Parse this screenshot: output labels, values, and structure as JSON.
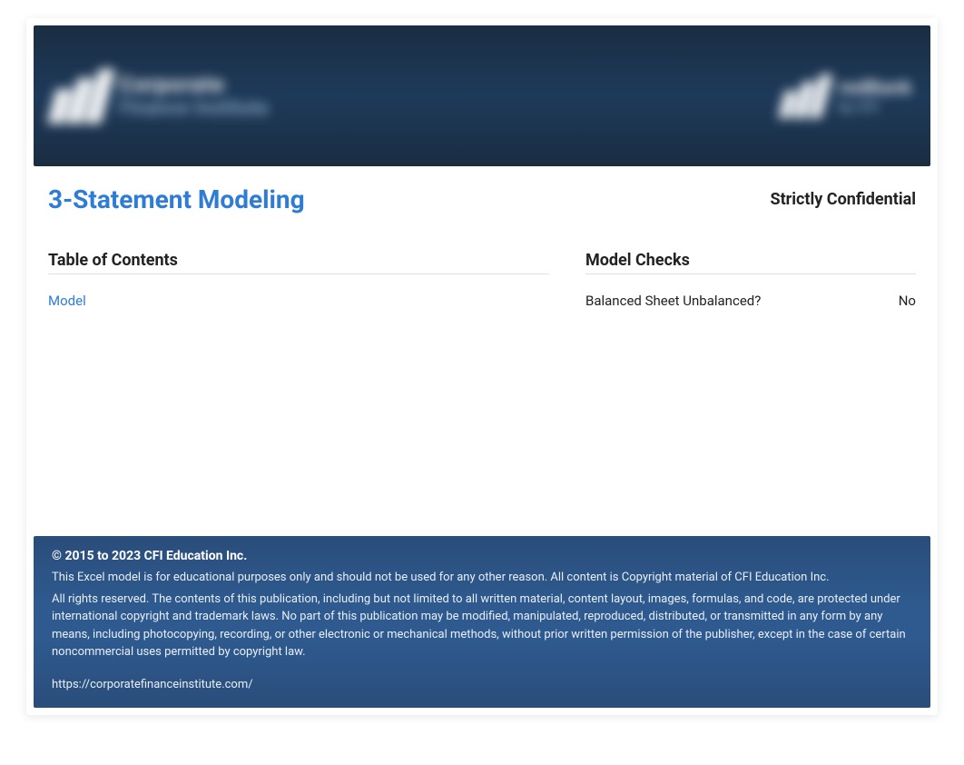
{
  "header": {
    "logo_left_line1": "Corporate",
    "logo_left_line2": "Finance Institute",
    "logo_right_line1": "redBank",
    "logo_right_line2": "by CFI"
  },
  "title": "3-Statement Modeling",
  "confidential": "Strictly Confidential",
  "toc": {
    "heading": "Table of Contents",
    "items": [
      {
        "label": "Model"
      }
    ]
  },
  "checks": {
    "heading": "Model Checks",
    "rows": [
      {
        "label": "Balanced Sheet Unbalanced?",
        "value": "No"
      }
    ]
  },
  "footer": {
    "copyright": "© 2015 to 2023 CFI Education Inc.",
    "disclaimer1": "This Excel model is for educational purposes only and should not be used for any other reason. All content is Copyright material of CFI Education Inc.",
    "disclaimer2": "All rights reserved.  The contents of this publication, including but not limited to all written material, content layout, images, formulas, and code, are protected under international copyright and trademark laws.  No part of this publication may be modified, manipulated, reproduced, distributed, or transmitted in any form by any means, including photocopying, recording, or other electronic or mechanical methods, without prior written permission of the publisher, except in the case of certain noncommercial uses permitted by copyright law.",
    "url": "https://corporatefinanceinstitute.com/"
  }
}
